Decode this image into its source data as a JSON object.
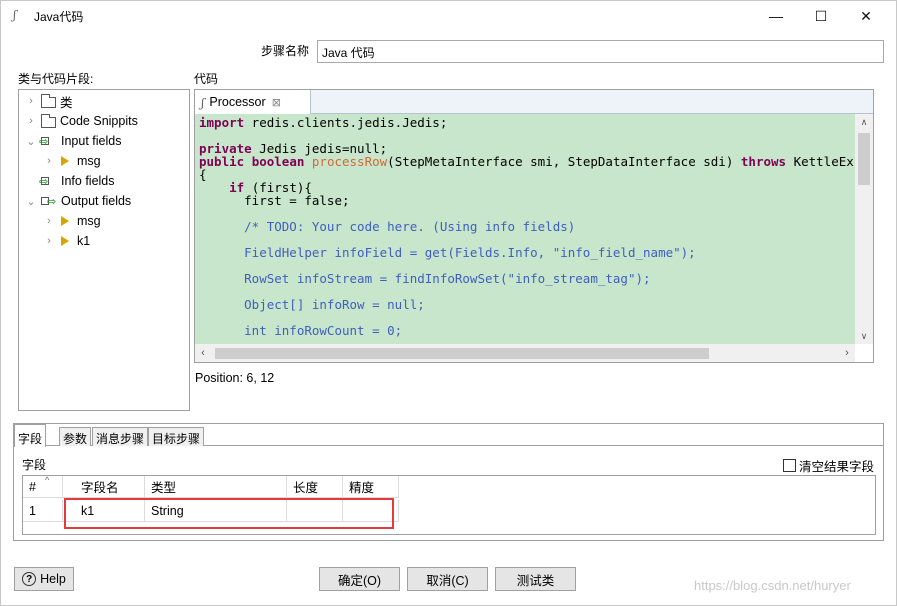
{
  "window": {
    "title": "Java代码",
    "minimize": "—",
    "maximize": "☐",
    "close": "✕"
  },
  "step": {
    "label": "步骤名称",
    "value": "Java 代码"
  },
  "tree": {
    "label": "类与代码片段:",
    "items": [
      {
        "text": "类"
      },
      {
        "text": "Code Snippits"
      },
      {
        "text": "Input fields"
      },
      {
        "text": "msg"
      },
      {
        "text": "Info fields"
      },
      {
        "text": "Output fields"
      },
      {
        "text": "msg"
      },
      {
        "text": "k1"
      }
    ]
  },
  "editor": {
    "label": "代码",
    "tab": "Processor",
    "tab_close": "⊠",
    "position": "Position: 6, 12",
    "lines": [
      "import redis.clients.jedis.Jedis;",
      "",
      "private Jedis jedis=null;",
      "public boolean processRow(StepMetaInterface smi, StepDataInterface sdi) throws KettleExc",
      "{",
      "    if (first){",
      "      first = false;",
      "",
      "      /* TODO: Your code here. (Using info fields)",
      "",
      "      FieldHelper infoField = get(Fields.Info, \"info_field_name\");",
      "",
      "      RowSet infoStream = findInfoRowSet(\"info_stream_tag\");",
      "",
      "      Object[] infoRow = null;",
      "",
      "      int infoRowCount = 0;"
    ]
  },
  "bottom_tabs": [
    "字段",
    "参数",
    "消息步骤",
    "目标步骤"
  ],
  "fields": {
    "label": "字段",
    "clear_label": "清空结果字段",
    "columns": [
      "#",
      "字段名",
      "类型",
      "长度",
      "精度"
    ],
    "rows": [
      {
        "num": "1",
        "name": "k1",
        "type": "String",
        "length": "",
        "precision": ""
      }
    ]
  },
  "buttons": {
    "help": "Help",
    "ok": "确定(O)",
    "cancel": "取消(C)",
    "test": "测试类"
  },
  "watermark": "https://blog.csdn.net/huryer",
  "colors": {
    "code_bg": "#c8e6cb",
    "keyword": "#7f0055",
    "method": "#d2693a",
    "highlight": "#e23b3b"
  }
}
